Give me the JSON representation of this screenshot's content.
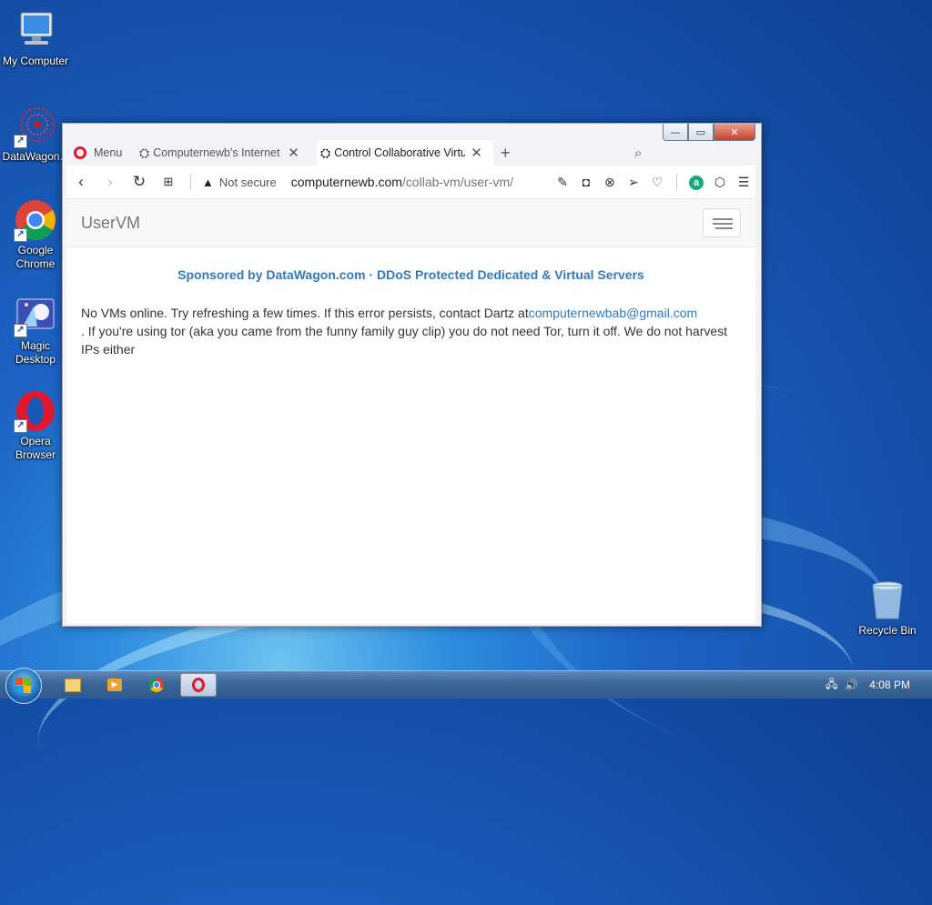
{
  "desktop": {
    "icons": [
      {
        "label": "My Computer"
      },
      {
        "label": "DataWagon..."
      },
      {
        "label": "Google Chrome"
      },
      {
        "label": "Magic Desktop"
      },
      {
        "label": "Opera Browser"
      },
      {
        "label": "Recycle Bin"
      }
    ]
  },
  "browser": {
    "menu_label": "Menu",
    "tabs": [
      {
        "title": "Computernewb's Internet F"
      },
      {
        "title": "Control Collaborative Virtu"
      }
    ],
    "new_tab_symbol": "+",
    "security_label": "Not secure",
    "url_host": "computernewb.com",
    "url_path": "/collab-vm/user-vm/",
    "window_controls": {
      "minimize": "—",
      "maximize": "▭",
      "close": "✕"
    }
  },
  "page": {
    "brand": "UserVM",
    "sponsor_text": "Sponsored by DataWagon.com · DDoS Protected Dedicated & Virtual Servers",
    "message_before": "No VMs online. Try refreshing a few times. If this error persists, contact Dartz at",
    "contact_email": "computernewbab@gmail.com",
    "message_after": ". If you're using tor (aka you came from the funny family guy clip) you do not need Tor, turn it off. We do not harvest IPs either"
  },
  "taskbar": {
    "time": "4:08 PM"
  },
  "colors": {
    "link": "#337ab7",
    "opera_red": "#e0182d"
  }
}
